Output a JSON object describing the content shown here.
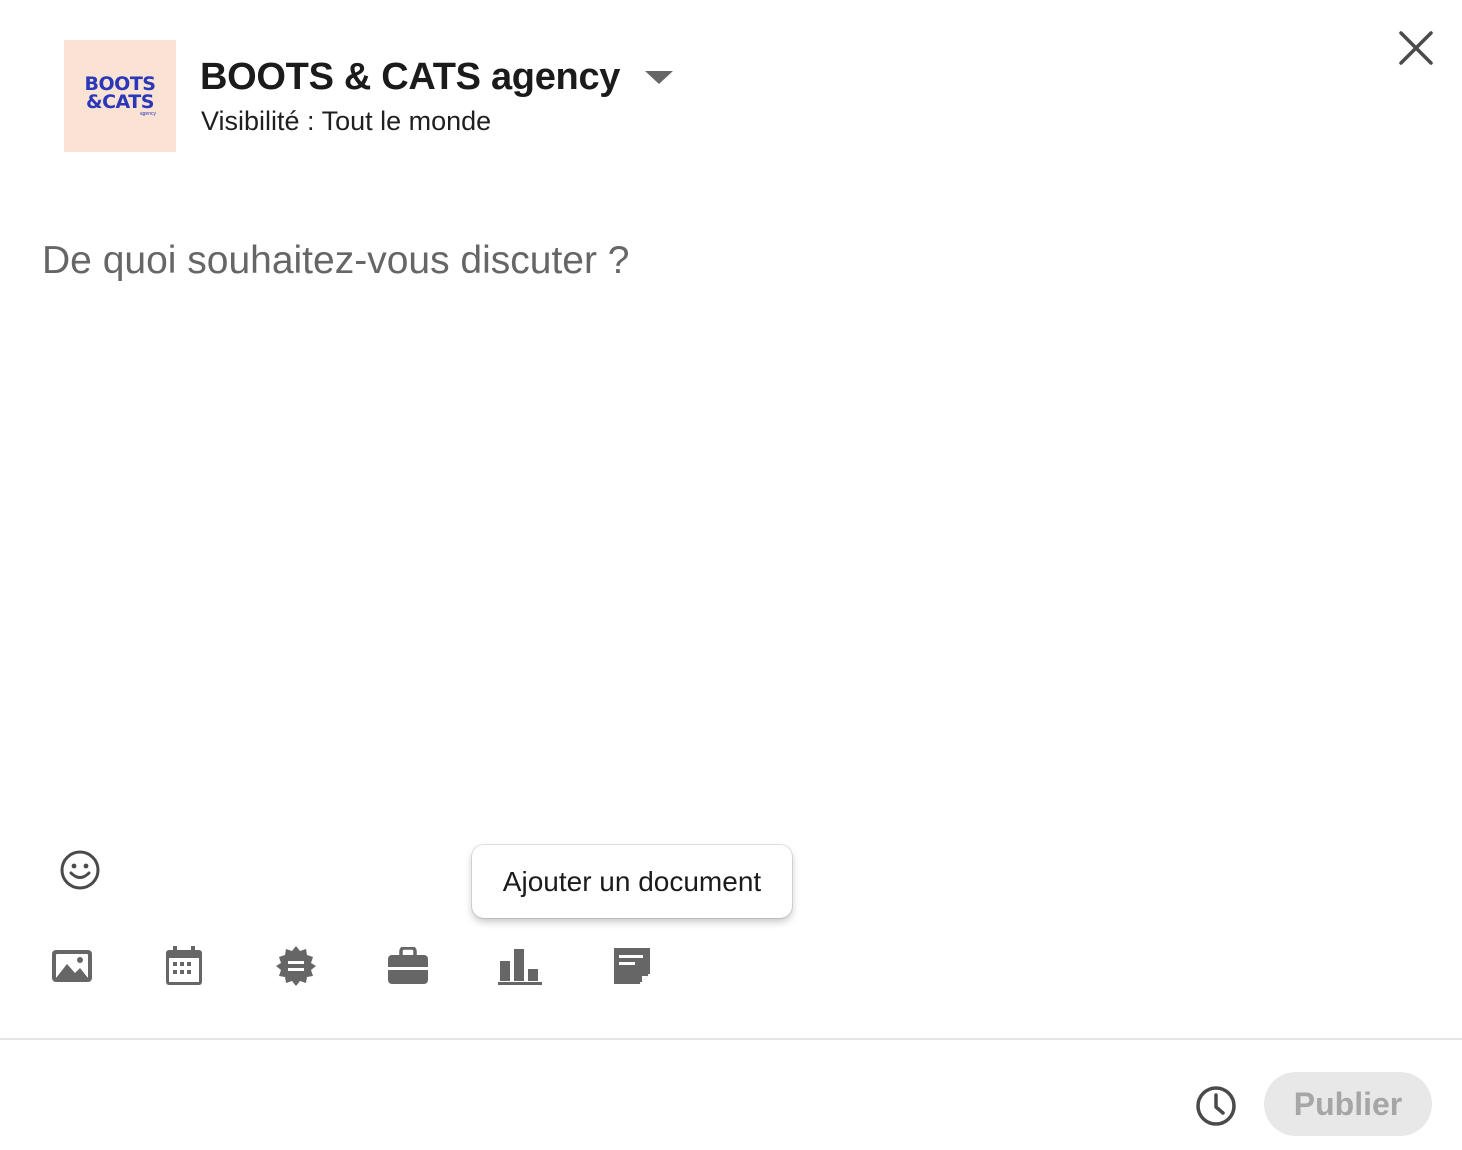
{
  "header": {
    "logo_lines": [
      "BOOTS",
      "&CATS"
    ],
    "logo_sub": "agency",
    "actor_name": "BOOTS & CATS agency",
    "visibility": "Visibilité : Tout le monde"
  },
  "editor": {
    "placeholder": "De quoi souhaitez-vous discuter ?"
  },
  "tooltip": {
    "text": "Ajouter un document"
  },
  "toolbar": {
    "items": [
      {
        "icon": "image-icon"
      },
      {
        "icon": "calendar-icon"
      },
      {
        "icon": "badge-icon"
      },
      {
        "icon": "briefcase-icon"
      },
      {
        "icon": "poll-icon"
      },
      {
        "icon": "document-icon"
      }
    ]
  },
  "footer": {
    "publish_label": "Publier"
  },
  "colors": {
    "logo_bg": "#fae3d4",
    "logo_text": "#2a37b8",
    "icon": "#666666",
    "publish_bg": "#e8e8e8",
    "publish_text": "#a6a6a6"
  }
}
